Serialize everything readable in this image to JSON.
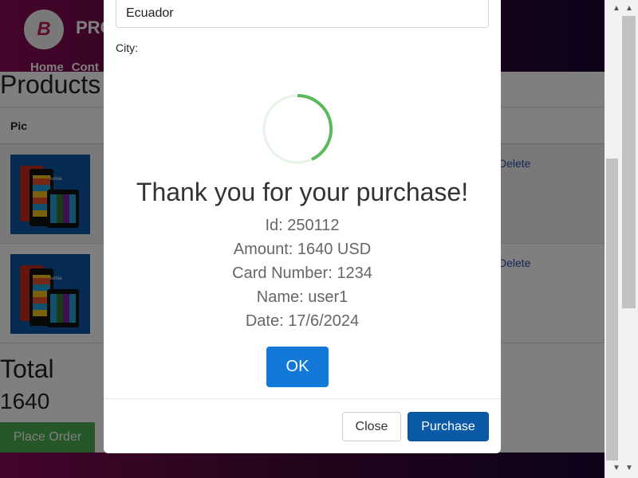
{
  "page": {
    "brand_initial": "B",
    "brand_text": "PRO",
    "nav": [
      "Home",
      "Cont"
    ],
    "title": "Products",
    "table_header_pic": "Pic",
    "table_header_right": ":",
    "rows": [
      {
        "delete_label": "Delete",
        "image_caption": "lumia"
      },
      {
        "delete_label": "Delete",
        "image_caption": "lumia"
      }
    ],
    "total_label": "Total",
    "total_value": "1640",
    "place_order_label": "Place Order"
  },
  "modal": {
    "country_value": "Ecuador",
    "city_label": "City:",
    "close_label": "Close",
    "purchase_label": "Purchase"
  },
  "alert": {
    "title": "Thank you for your purchase!",
    "id_line": "Id: 250112",
    "amount_line": "Amount: 1640 USD",
    "card_line": "Card Number: 1234",
    "name_line": "Name: user1",
    "date_line": "Date: 17/6/2024",
    "ok_label": "OK",
    "spinner_color": "#5cb85c"
  },
  "scrollbar": {
    "up_icon": "▲",
    "down_icon": "▼"
  }
}
